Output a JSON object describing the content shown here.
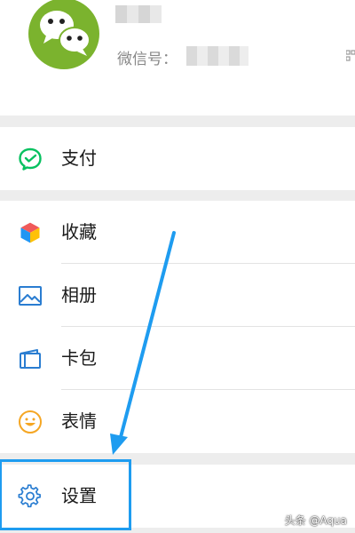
{
  "profile": {
    "wechat_id_label": "微信号："
  },
  "menu": {
    "pay": "支付",
    "favorites": "收藏",
    "album": "相册",
    "cards": "卡包",
    "stickers": "表情",
    "settings": "设置"
  },
  "watermark": "头条 @Aqua",
  "colors": {
    "pay_green": "#07c160",
    "annotation_blue": "#1e9cf0",
    "settings_icon": "#2a7dd1"
  },
  "icons": {
    "pay": "pay-check-icon",
    "favorites": "cube-icon",
    "album": "image-icon",
    "cards": "wallet-icon",
    "stickers": "smile-icon",
    "settings": "gear-icon"
  }
}
